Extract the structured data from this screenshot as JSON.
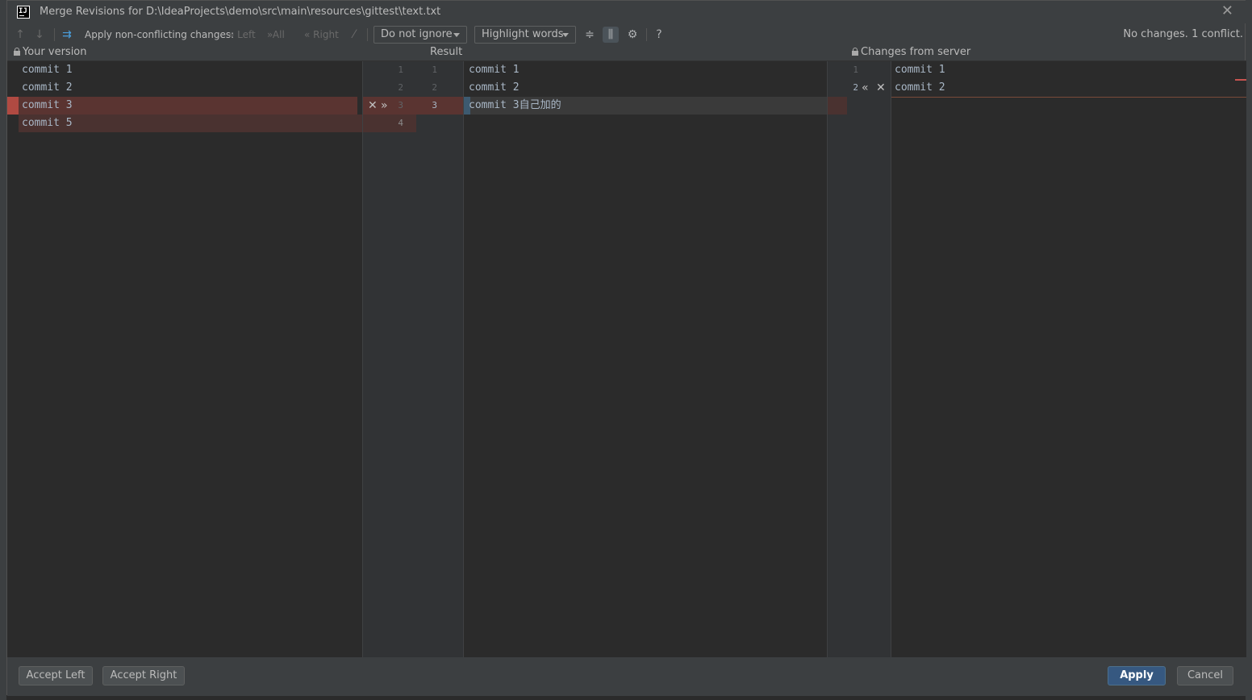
{
  "window": {
    "title": "Merge Revisions for D:\\IdeaProjects\\demo\\src\\main\\resources\\gittest\\text.txt",
    "app_icon_label": "IJ"
  },
  "toolbar": {
    "apply_non_conflicting_label": "Apply non-conflicting changes:",
    "left_label": "Left",
    "all_label": "All",
    "right_label": "Right",
    "ignore_select_value": "Do not ignore",
    "highlight_select_value": "Highlight words",
    "help_label": "?",
    "status": "No changes. 1 conflict."
  },
  "panes": {
    "left_header": "Your version",
    "center_header": "Result",
    "right_header": "Changes from server"
  },
  "left_lines": [
    "commit 1",
    "commit 2",
    "commit 3",
    "commit 5"
  ],
  "center_left_numbers": [
    "1",
    "2",
    "3",
    "4"
  ],
  "center_right_numbers": [
    "1",
    "2",
    "3"
  ],
  "result_lines": [
    "commit 1",
    "commit 2",
    "commit 3自己加的"
  ],
  "right_numbers": [
    "1",
    "2"
  ],
  "right_lines": [
    "commit 1",
    "commit 2"
  ],
  "footer": {
    "accept_left": "Accept Left",
    "accept_right": "Accept Right",
    "apply": "Apply",
    "cancel": "Cancel"
  },
  "colors": {
    "conflict": "#5a3431",
    "primary_button": "#365880"
  }
}
